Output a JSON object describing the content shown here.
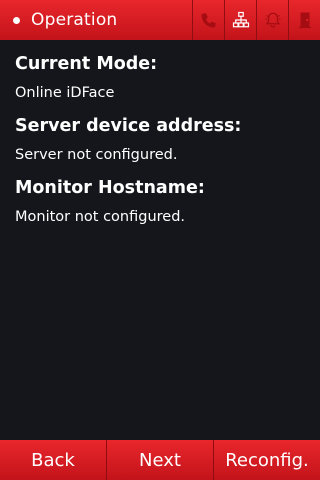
{
  "header": {
    "title": "Operation",
    "icons": [
      "phone-icon",
      "network-icon",
      "alarm-bell-icon",
      "door-icon"
    ],
    "icon_color": "#a50d12"
  },
  "main": {
    "sections": [
      {
        "heading": "Current Mode:",
        "value": "Online iDFace"
      },
      {
        "heading": "Server device address:",
        "value": "Server not configured."
      },
      {
        "heading": "Monitor Hostname:",
        "value": "Monitor not configured."
      }
    ]
  },
  "footer": {
    "back_label": "Back",
    "next_label": "Next",
    "reconfig_label": "Reconfig."
  },
  "colors": {
    "accent": "#d91c22",
    "background": "#14161b",
    "text": "#ffffff"
  }
}
